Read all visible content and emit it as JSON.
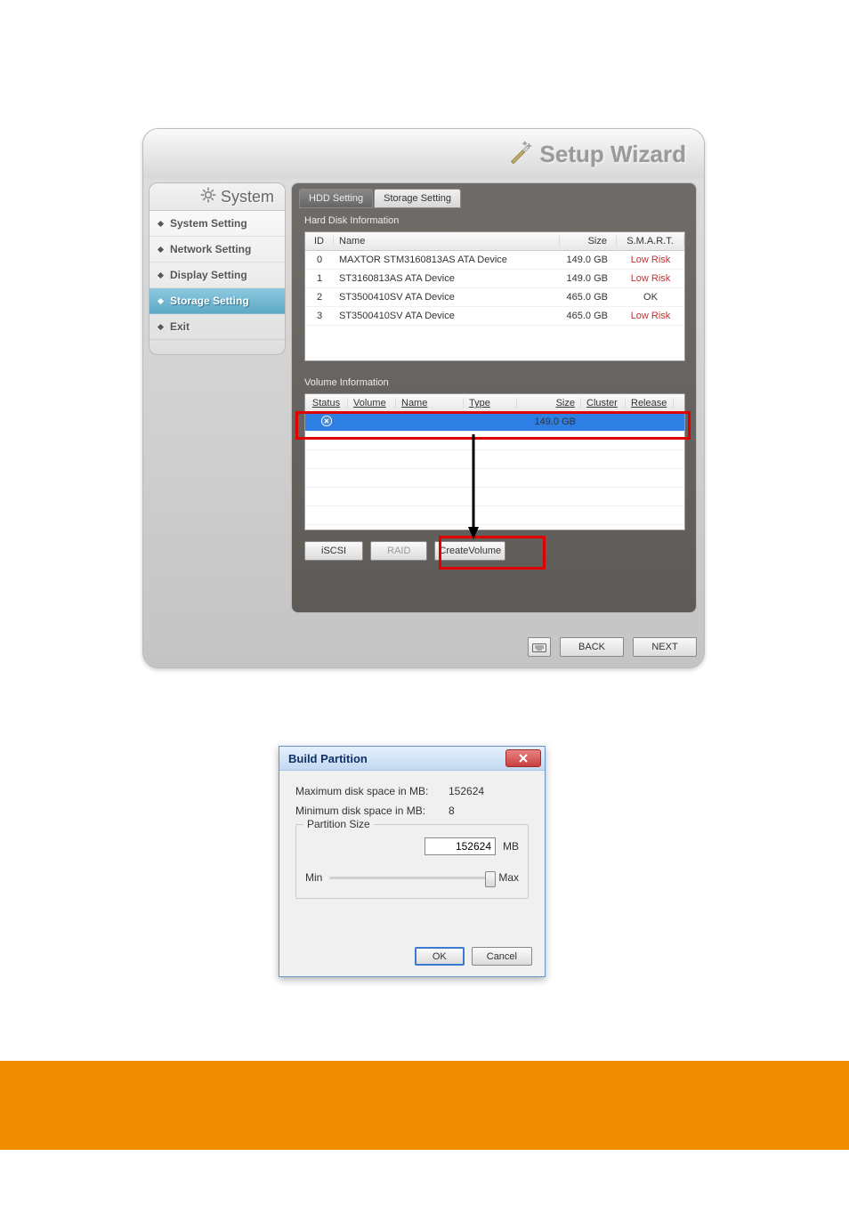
{
  "window": {
    "title": "Setup Wizard"
  },
  "sidebar": {
    "header": "System",
    "items": [
      {
        "label": "System Setting",
        "selected": false
      },
      {
        "label": "Network Setting",
        "selected": false
      },
      {
        "label": "Display Setting",
        "selected": false
      },
      {
        "label": "Storage Setting",
        "selected": true
      },
      {
        "label": "Exit",
        "selected": false
      }
    ]
  },
  "tabs": {
    "active": "HDD Setting",
    "inactive": "Storage Setting"
  },
  "sections": {
    "hdd_label": "Hard Disk Information",
    "vol_label": "Volume Information"
  },
  "hdd_table": {
    "headers": {
      "id": "ID",
      "name": "Name",
      "size": "Size",
      "smart": "S.M.A.R.T."
    },
    "rows": [
      {
        "id": "0",
        "name": "MAXTOR STM3160813AS ATA Device",
        "size": "149.0 GB",
        "smart": "Low Risk",
        "smart_class": "risk-low"
      },
      {
        "id": "1",
        "name": "ST3160813AS ATA Device",
        "size": "149.0 GB",
        "smart": "Low Risk",
        "smart_class": "risk-low"
      },
      {
        "id": "2",
        "name": "ST3500410SV ATA Device",
        "size": "465.0 GB",
        "smart": "OK",
        "smart_class": "risk-ok"
      },
      {
        "id": "3",
        "name": "ST3500410SV ATA Device",
        "size": "465.0 GB",
        "smart": "Low Risk",
        "smart_class": "risk-low"
      }
    ]
  },
  "vol_table": {
    "headers": {
      "status": "Status",
      "volume": "Volume",
      "name": "Name",
      "type": "Type",
      "size": "Size",
      "cluster": "Cluster",
      "release": "Release"
    },
    "rows": [
      {
        "status": "info",
        "volume": "",
        "name": "",
        "type": "",
        "size": "149.0 GB",
        "cluster": "",
        "release": ""
      }
    ]
  },
  "actions": {
    "iscsi": "iSCSI",
    "raid": "RAID",
    "create": "CreateVolume"
  },
  "footer": {
    "back": "BACK",
    "next": "NEXT"
  },
  "dialog": {
    "title": "Build Partition",
    "max_label": "Maximum disk space in MB:",
    "max_value": "152624",
    "min_label": "Minimum disk space in MB:",
    "min_value": "8",
    "fieldset_label": "Partition Size",
    "partition_value": "152624",
    "mb_label": "MB",
    "min_slider": "Min",
    "max_slider": "Max",
    "ok": "OK",
    "cancel": "Cancel"
  }
}
